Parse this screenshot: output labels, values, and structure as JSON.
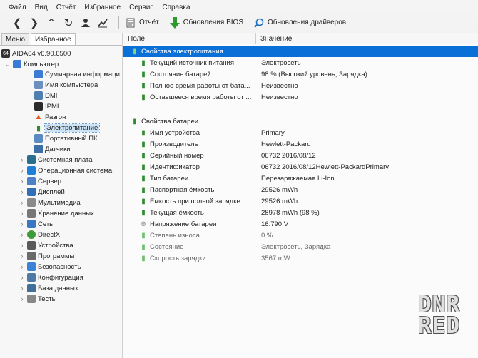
{
  "menu": [
    "Файл",
    "Вид",
    "Отчёт",
    "Избранное",
    "Сервис",
    "Справка"
  ],
  "toolbar": {
    "report_label": "Отчёт",
    "bios_label": "Обновления BIOS",
    "drivers_label": "Обновления драйверов"
  },
  "left": {
    "tabs": [
      "Меню",
      "Избранное"
    ],
    "app_version": "AIDA64 v6.90.6500",
    "tree": [
      {
        "label": "Компьютер"
      },
      {
        "label": "Суммарная информаци"
      },
      {
        "label": "Имя компьютера"
      },
      {
        "label": "DMI"
      },
      {
        "label": "IPMI"
      },
      {
        "label": "Разгон"
      },
      {
        "label": "Электропитание"
      },
      {
        "label": "Портативный ПК"
      },
      {
        "label": "Датчики"
      },
      {
        "label": "Системная плата"
      },
      {
        "label": "Операционная система"
      },
      {
        "label": "Сервер"
      },
      {
        "label": "Дисплей"
      },
      {
        "label": "Мультимедиа"
      },
      {
        "label": "Хранение данных"
      },
      {
        "label": "Сеть"
      },
      {
        "label": "DirectX"
      },
      {
        "label": "Устройства"
      },
      {
        "label": "Программы"
      },
      {
        "label": "Безопасность"
      },
      {
        "label": "Конфигурация"
      },
      {
        "label": "База данных"
      },
      {
        "label": "Тесты"
      }
    ]
  },
  "right": {
    "col_field": "Поле",
    "col_value": "Значение",
    "section1": "Свойства электропитания",
    "rows1": [
      {
        "field": "Текущий источник питания",
        "value": "Электросеть"
      },
      {
        "field": "Состояние батарей",
        "value": "98 % (Высокий уровень, Зарядка)"
      },
      {
        "field": "Полное время работы от бата...",
        "value": "Неизвестно"
      },
      {
        "field": "Оставшееся время работы от ...",
        "value": "Неизвестно"
      }
    ],
    "section2": "Свойства батареи",
    "rows2": [
      {
        "field": "Имя устройства",
        "value": "Primary"
      },
      {
        "field": "Производитель",
        "value": "Hewlett-Packard"
      },
      {
        "field": "Серийный номер",
        "value": "06732 2016/08/12"
      },
      {
        "field": "Идентификатор",
        "value": "06732 2016/08/12Hewlett-PackardPrimary"
      },
      {
        "field": "Тип батареи",
        "value": "Перезаряжаемая Li-Ion"
      },
      {
        "field": "Паспортная ёмкость",
        "value": "29526 mWh"
      },
      {
        "field": "Ёмкость при полной зарядке",
        "value": "29526 mWh"
      },
      {
        "field": "Текущая ёмкость",
        "value": "28978 mWh  (98 %)"
      },
      {
        "field": "Напряжение батареи",
        "value": "16.790 V"
      },
      {
        "field": "Степень износа",
        "value": "0 %"
      },
      {
        "field": "Состояние",
        "value": "Электросеть, Зарядка"
      },
      {
        "field": "Скорость зарядки",
        "value": "3567 mW"
      }
    ]
  },
  "watermark": [
    "DNR",
    "RED"
  ]
}
